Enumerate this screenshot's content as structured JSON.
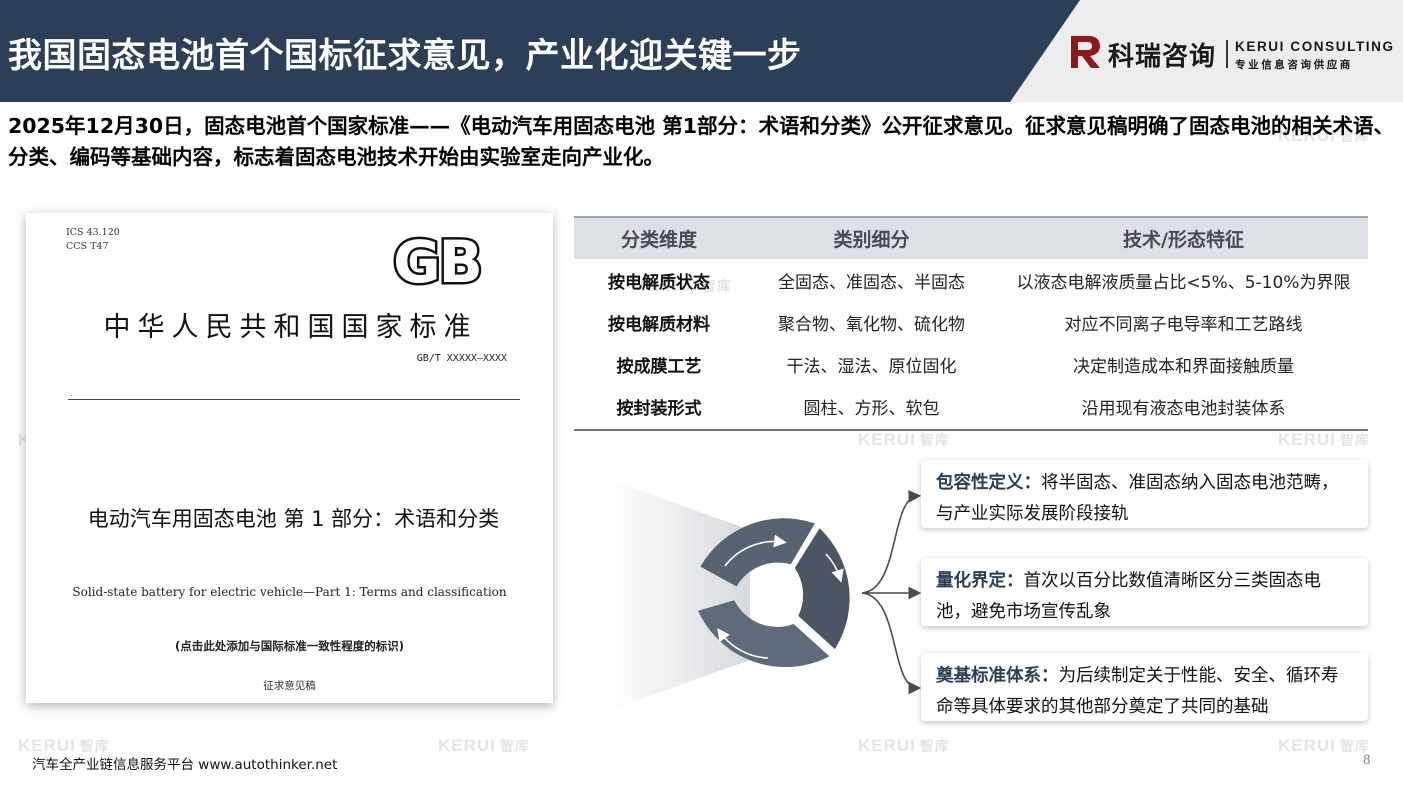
{
  "header": {
    "title": "我国固态电池首个国标征求意见，产业化迎关键一步",
    "brand_name_cn": "科瑞咨询",
    "brand_name_en": "KERUI CONSULTING",
    "brand_tagline": "专业信息咨询供应商",
    "colors": {
      "band": "#2c3e58",
      "accent": "#8b1a1f",
      "corner": "#ededed"
    }
  },
  "intro": "2025年12月30日，固态电池首个国家标准——《电动汽车用固态电池 第1部分：术语和分类》公开征求意见。征求意见稿明确了固态电池的相关术语、分类、编码等基础内容，标志着固态电池技术开始由实验室走向产业化。",
  "document": {
    "ics": "ICS  43.120",
    "ccs": "CCS  T47",
    "logo_text": "GB",
    "standard_cn": "中华人民共和国国家标准",
    "code": "GB/T XXXXX—XXXX",
    "dot": ".",
    "title_cn": "电动汽车用固态电池  第 1 部分：术语和分类",
    "title_en": "Solid-state battery for electric vehicle—Part 1: Terms and classification",
    "note": "(点击此处添加与国际标准一致性程度的标识)",
    "draft": "征求意见稿"
  },
  "table": {
    "headers": [
      "分类维度",
      "类别细分",
      "技术/形态特征"
    ],
    "rows": [
      [
        "按电解质状态",
        "全固态、准固态、半固态",
        "以液态电解液质量占比<5%、5-10%为界限"
      ],
      [
        "按电解质材料",
        "聚合物、氧化物、硫化物",
        "对应不同离子电导率和工艺路线"
      ],
      [
        "按成膜工艺",
        "干法、湿法、原位固化",
        "决定制造成本和界面接触质量"
      ],
      [
        "按封装形式",
        "圆柱、方形、软包",
        "沿用现有液态电池封装体系"
      ]
    ]
  },
  "features": [
    {
      "label": "包容性定义：",
      "text": "将半固态、准固态纳入固态电池范畴，与产业实际发展阶段接轨"
    },
    {
      "label": "量化界定：",
      "text": "首次以百分比数值清晰区分三类固态电池，避免市场宣传乱象"
    },
    {
      "label": "奠基标准体系：",
      "text": "为后续制定关于性能、安全、循环寿命等具体要求的其他部分奠定了共同的基础"
    }
  ],
  "watermark": {
    "en": "KERUI",
    "cn": "智库"
  },
  "footer": {
    "platform": "汽车全产业链信息服务平台 www.autothinker.net",
    "page": "8"
  }
}
